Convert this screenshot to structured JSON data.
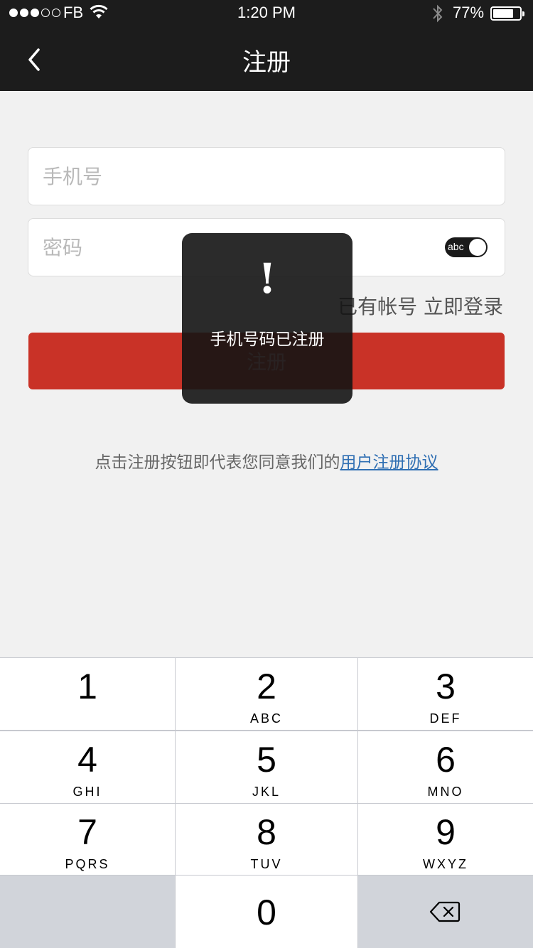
{
  "status_bar": {
    "carrier": "FB",
    "time": "1:20 PM",
    "battery": "77%",
    "icons": [
      "signal-dots",
      "wifi-icon",
      "bluetooth-icon",
      "battery-icon"
    ]
  },
  "nav": {
    "title": "注册",
    "back_icon": "chevron-left-icon"
  },
  "form": {
    "phone_placeholder": "手机号",
    "password_placeholder": "密码",
    "password_toggle_label": "abc",
    "login_link": "已有帐号 立即登录",
    "register_button": "注册",
    "agreement_text": "点击注册按钮即代表您同意我们的",
    "agreement_link": "用户注册协议"
  },
  "toast": {
    "icon": "!",
    "message": "手机号码已注册"
  },
  "keypad": {
    "keys": [
      {
        "num": "1",
        "letters": ""
      },
      {
        "num": "2",
        "letters": "ABC"
      },
      {
        "num": "3",
        "letters": "DEF"
      },
      {
        "num": "4",
        "letters": "GHI"
      },
      {
        "num": "5",
        "letters": "JKL"
      },
      {
        "num": "6",
        "letters": "MNO"
      },
      {
        "num": "7",
        "letters": "PQRS"
      },
      {
        "num": "8",
        "letters": "TUV"
      },
      {
        "num": "9",
        "letters": "WXYZ"
      },
      {
        "num": "0",
        "letters": ""
      }
    ],
    "delete_icon": "backspace-icon"
  },
  "colors": {
    "nav_bg": "#1c1c1c",
    "page_bg": "#f1f1f1",
    "accent_red": "#c93227",
    "link_blue": "#2f6fb3"
  }
}
